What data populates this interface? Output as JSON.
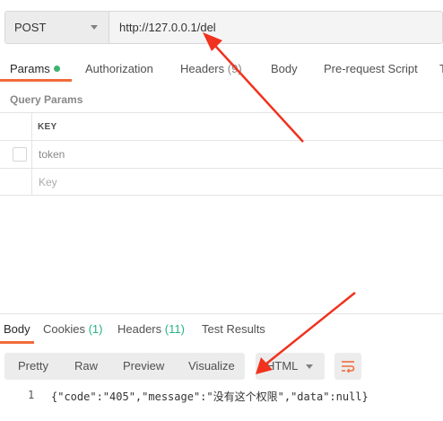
{
  "request": {
    "method": "POST",
    "url": "http://127.0.0.1/del"
  },
  "request_tabs": {
    "params": "Params",
    "authorization": "Authorization",
    "headers": "Headers",
    "headers_count": "(9)",
    "body": "Body",
    "prerequest": "Pre-request Script",
    "overflow": "T"
  },
  "query_params": {
    "title": "Query Params",
    "column_key": "KEY",
    "rows": [
      {
        "key": "token"
      }
    ],
    "placeholder_key": "Key"
  },
  "response_tabs": {
    "body": "Body",
    "cookies": "Cookies",
    "cookies_count": "(1)",
    "headers": "Headers",
    "headers_count": "(11)",
    "test_results": "Test Results"
  },
  "response_view": {
    "pretty": "Pretty",
    "raw": "Raw",
    "preview": "Preview",
    "visualize": "Visualize",
    "format": "HTML"
  },
  "response_body": {
    "line_number": "1",
    "text": "{\"code\":\"405\",\"message\":\"没有这个权限\",\"data\":null}"
  },
  "colors": {
    "accent": "#f26b3a",
    "annotation_arrow": "#f0321e",
    "count_green": "#26b47f"
  }
}
